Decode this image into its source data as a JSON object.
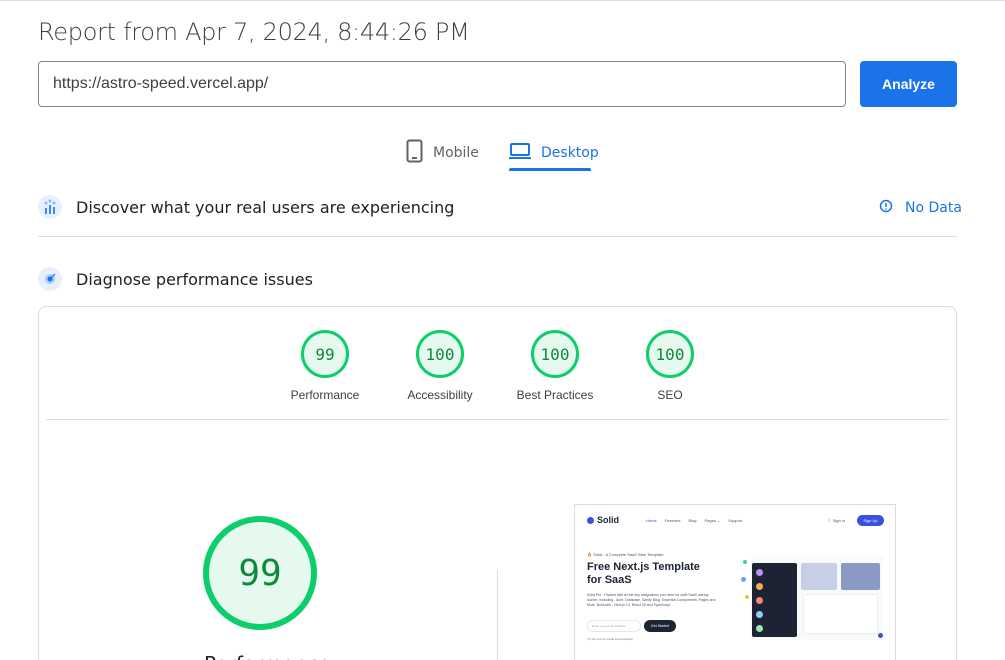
{
  "report": {
    "title": "Report from Apr 7, 2024, 8:44:26 PM"
  },
  "url_input": {
    "value": "https://astro-speed.vercel.app/"
  },
  "analyze_button": {
    "label": "Analyze"
  },
  "tabs": [
    {
      "label": "Mobile",
      "icon": "phone-icon",
      "active": false
    },
    {
      "label": "Desktop",
      "icon": "laptop-icon",
      "active": true
    }
  ],
  "real_users": {
    "title": "Discover what your real users are experiencing",
    "status": "No Data"
  },
  "diagnose": {
    "title": "Diagnose performance issues"
  },
  "scores": [
    {
      "value": "99",
      "label": "Performance"
    },
    {
      "value": "100",
      "label": "Accessibility"
    },
    {
      "value": "100",
      "label": "Best Practices"
    },
    {
      "value": "100",
      "label": "SEO"
    }
  ],
  "main_score": {
    "value": "99",
    "label": "Performance"
  },
  "preview": {
    "logo": "Solid",
    "nav": [
      "Home",
      "Features",
      "Blog",
      "Pages ⌄",
      "Support"
    ],
    "sign_in": "Sign In",
    "sign_up": "Sign Up",
    "badge": "🔥 Solid - A Complete SaaS Web Template",
    "heading": "Free Next.js Template for SaaS",
    "description": "Solid Pro - Packed with all the key integrations you need for swift SaaS startup launch, including - Auth, Database, Sanity Blog, Essential Components, Pages and More. Built-with - Next.js 13, React 18 and TypeScript.",
    "email_placeholder": "Enter your email address",
    "cta": "Get Started",
    "note": "Try for free no credit card required."
  },
  "colors": {
    "accent": "#1a73e8",
    "score_good": "#0cce6b"
  }
}
